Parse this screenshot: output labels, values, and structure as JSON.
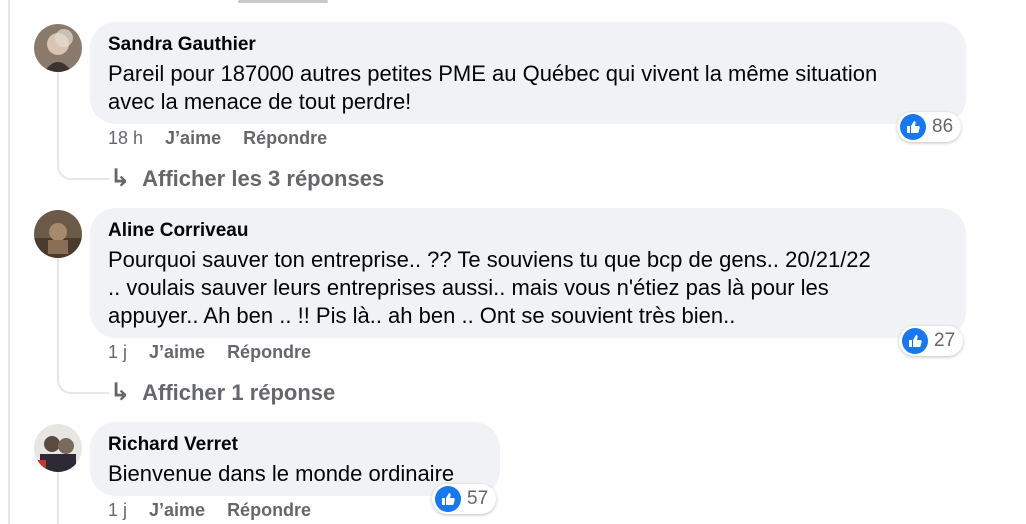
{
  "comments": [
    {
      "author": "Sandra Gauthier",
      "text": "Pareil pour 187000 autres petites PME au Québec qui vivent la même situation\navec la menace de tout perdre!",
      "time": "18 h",
      "like": "J’aime",
      "reply": "Répondre",
      "reactions": "86",
      "view_replies": "Afficher les 3 réponses"
    },
    {
      "author": "Aline Corriveau",
      "text": "Pourquoi sauver ton entreprise.. ?? Te souviens tu que bcp de gens.. 20/21/22\n.. voulais sauver leurs entreprises aussi.. mais vous n'étiez pas là pour les\nappuyer.. Ah ben .. !! Pis là.. ah ben .. Ont se souvient très bien..",
      "time": "1 j",
      "like": "J’aime",
      "reply": "Répondre",
      "reactions": "27",
      "view_replies": "Afficher 1 réponse"
    },
    {
      "author": "Richard Verret",
      "text": "Bienvenue dans le monde ordinaire",
      "time": "1 j",
      "like": "J’aime",
      "reply": "Répondre",
      "reactions": "57"
    }
  ],
  "icons": {
    "reaction": "like-thumb-icon",
    "reply_arrow": "reply-arrow-icon"
  },
  "colors": {
    "like_blue": "#1877f2",
    "bubble": "#f0f2f5",
    "meta_gray": "#65676b"
  }
}
